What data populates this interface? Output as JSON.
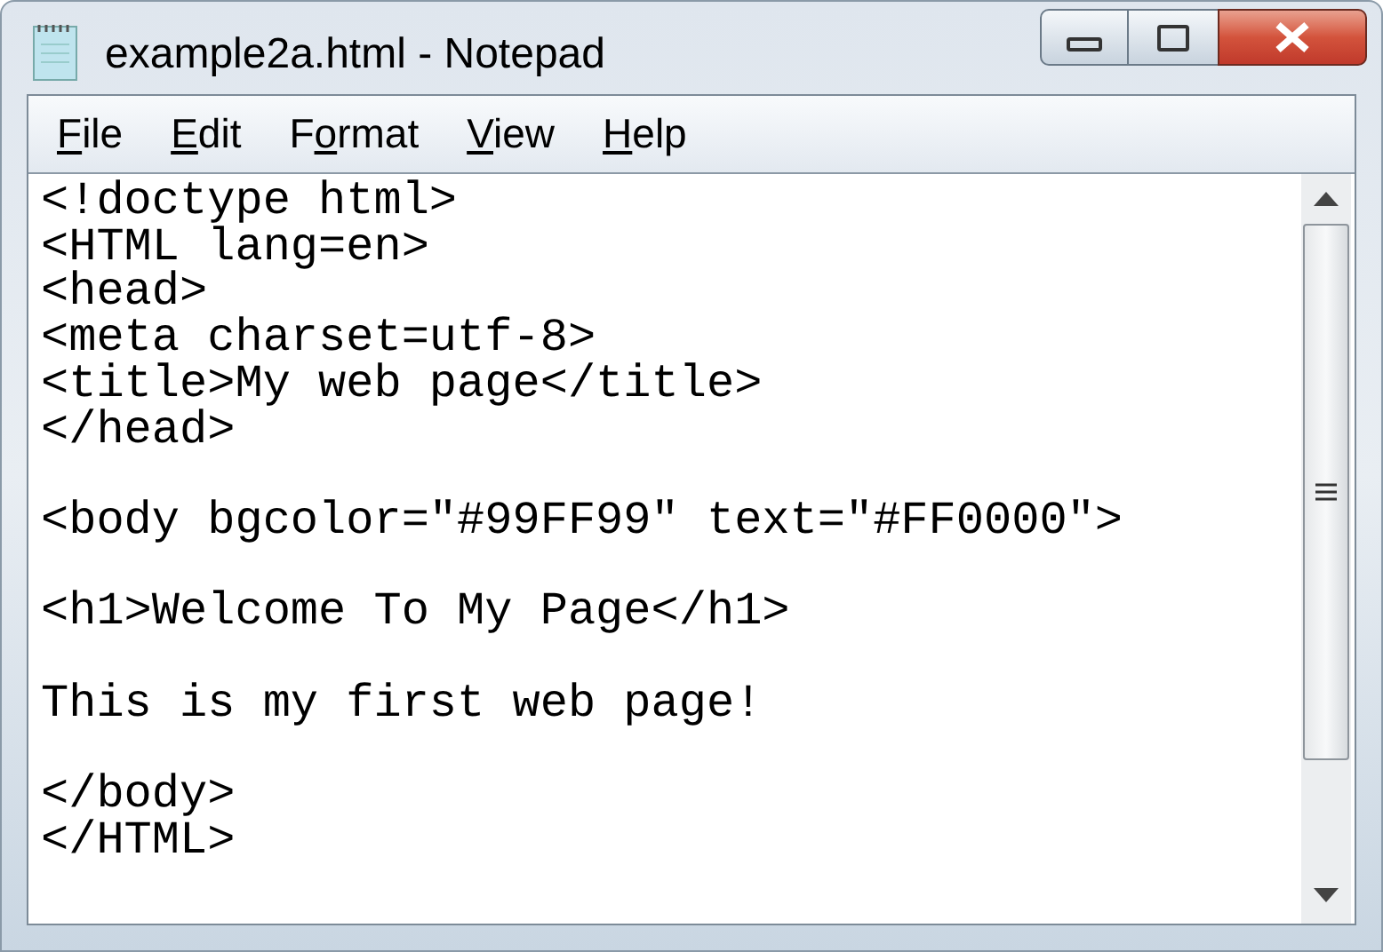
{
  "window": {
    "title": "example2a.html - Notepad"
  },
  "menu": [
    {
      "key": "F",
      "rest": "ile"
    },
    {
      "key": "E",
      "rest": "dit"
    },
    {
      "prefix": "F",
      "key": "o",
      "rest": "rmat"
    },
    {
      "key": "V",
      "rest": "iew"
    },
    {
      "key": "H",
      "rest": "elp"
    }
  ],
  "editor": {
    "text": "<!doctype html>\n<HTML lang=en>\n<head>\n<meta charset=utf-8>\n<title>My web page</title>\n</head>\n\n<body bgcolor=\"#99FF99\" text=\"#FF0000\">\n\n<h1>Welcome To My Page</h1>\n\nThis is my first web page!\n\n</body>\n</HTML>"
  }
}
